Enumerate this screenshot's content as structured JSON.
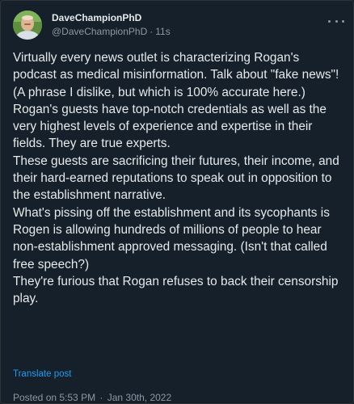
{
  "author": {
    "display_name": "DaveChampionPhD",
    "handle": "@DaveChampionPhD",
    "time_ago": "11s"
  },
  "tweet": {
    "text": "Virtually every news outlet is characterizing Rogan's podcast as medical misinformation. Talk about \"fake news\"! (A phrase I dislike, but which is 100% accurate here.)\nRogan's guests have top-notch credentials as well as the very highest levels of experience and expertise in their fields. They are true experts.\nThese guests are sacrificing their futures, their income, and their hard-earned reputations to speak out in opposition to the establishment narrative.\nWhat's pissing off the establishment and its sycophants is Rogen is allowing hundreds of millions of people to hear non-establishment approved messaging. (Isn't that called free speech?)\nThey're furious that Rogan refuses to back their censorship play.",
    "translate_label": "Translate post"
  },
  "meta": {
    "posted_time": "Posted on 5:53 PM",
    "posted_date": "Jan 30th, 2022"
  },
  "colors": {
    "background": "#15202b",
    "text": "#e7e9ea",
    "secondary": "#8b98a5",
    "link": "#1d9bf0"
  }
}
